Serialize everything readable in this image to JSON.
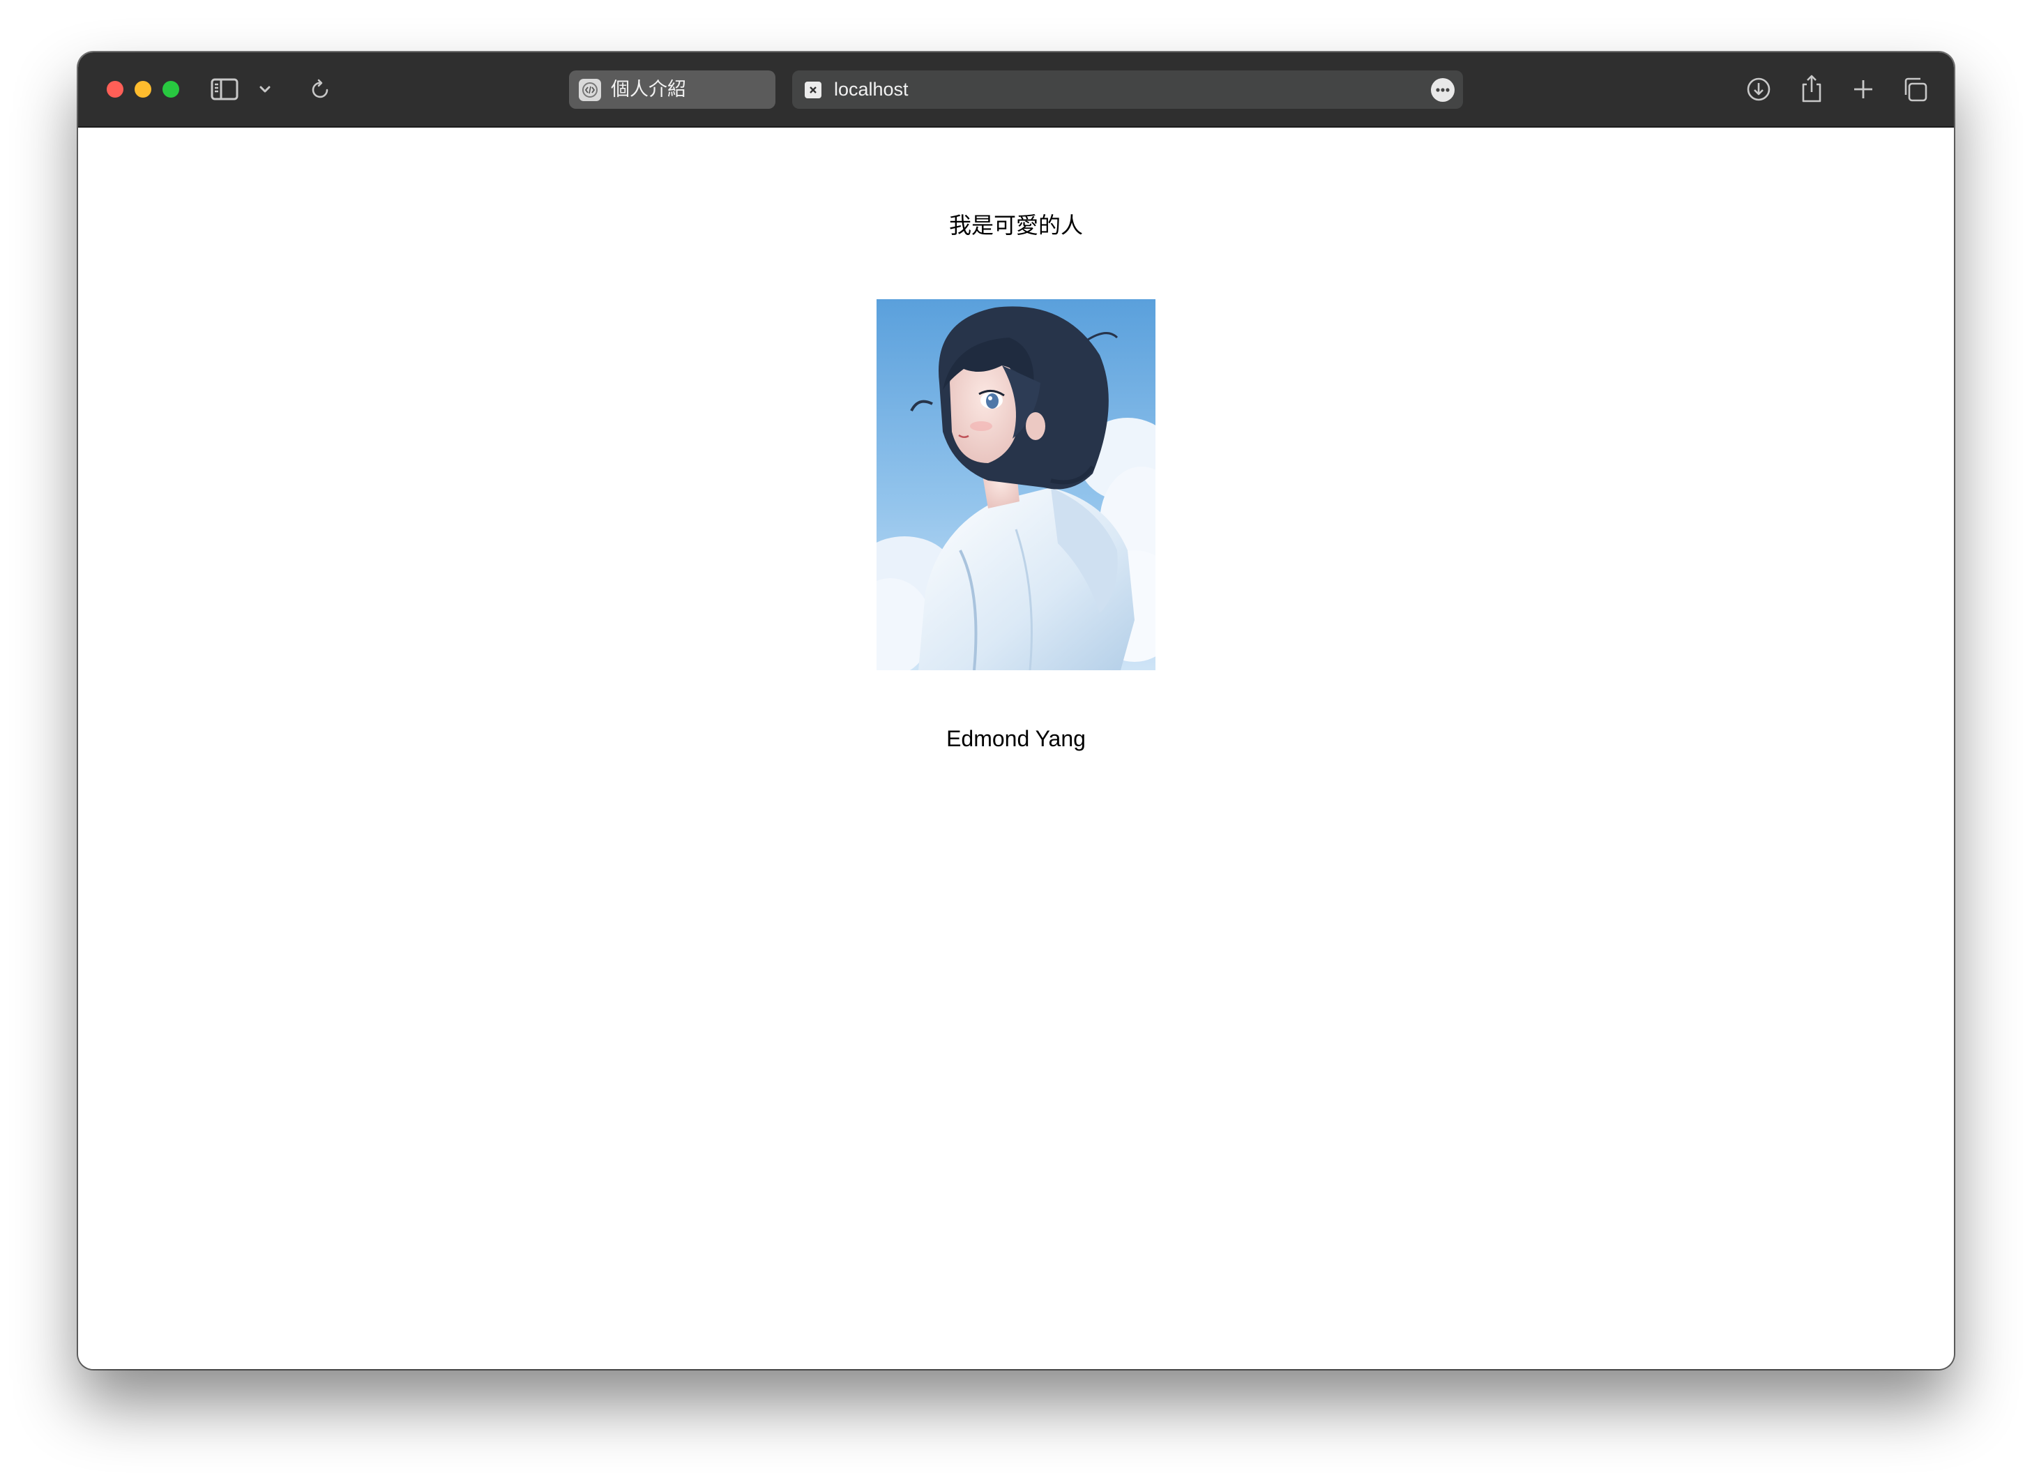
{
  "browser": {
    "tabs": [
      {
        "label": "個人介紹",
        "active": true,
        "icon": "code-page-icon"
      },
      {
        "label": "localhost",
        "active": false,
        "icon": "close-tab-icon"
      }
    ],
    "toolbar_icons": [
      "sidebar-toggle-icon",
      "chevron-down-icon",
      "reload-icon",
      "more-options-icon",
      "download-icon",
      "share-icon",
      "new-tab-icon",
      "tab-overview-icon"
    ],
    "colors": {
      "toolbar_bg": "#2f2f2f",
      "active_tab_bg": "#5b5b5b",
      "inactive_tab_bg": "#444545",
      "close_button": "#ff5f57",
      "minimize_button": "#febc2e",
      "zoom_button": "#28c840"
    }
  },
  "page": {
    "heading": "我是可愛的人",
    "image_subject": "anime-style portrait illustration: short dark-haired girl in a white hooded jacket looking back over her shoulder, blue sky with white clouds",
    "name": "Edmond Yang"
  }
}
